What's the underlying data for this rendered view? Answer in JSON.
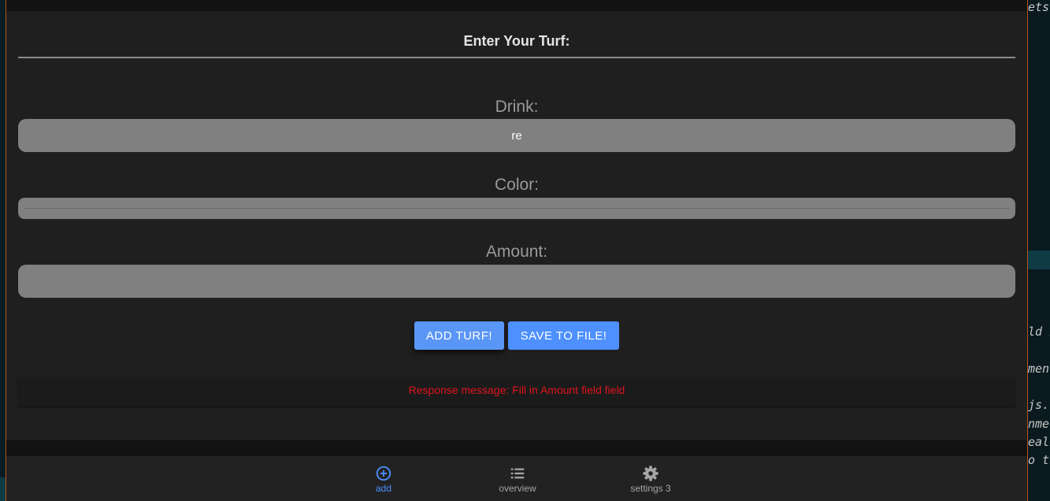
{
  "form": {
    "title": "Enter Your Turf:",
    "drink": {
      "label": "Drink:",
      "value": "re",
      "placeholder": ""
    },
    "color": {
      "label": "Color:"
    },
    "amount": {
      "label": "Amount:",
      "value": "",
      "placeholder": ""
    },
    "add_button_label": "Add turf!",
    "save_button_label": "Save to file!",
    "response_message": "Response message: Fill in Amount field field"
  },
  "nav": {
    "items": [
      {
        "label": "add",
        "icon": "add-circle-icon",
        "active": true
      },
      {
        "label": "overview",
        "icon": "list-icon",
        "active": false
      },
      {
        "label": "settings 3",
        "icon": "gear-icon",
        "active": false
      }
    ]
  },
  "background_editor": {
    "fragments": [
      "ets",
      "ld n",
      "ment",
      "js.",
      "nmer",
      "eali",
      "o th"
    ]
  },
  "colors": {
    "accent": "#4d90fe",
    "error": "#e0141c",
    "card": "#1f1f1f",
    "input": "#808080"
  }
}
